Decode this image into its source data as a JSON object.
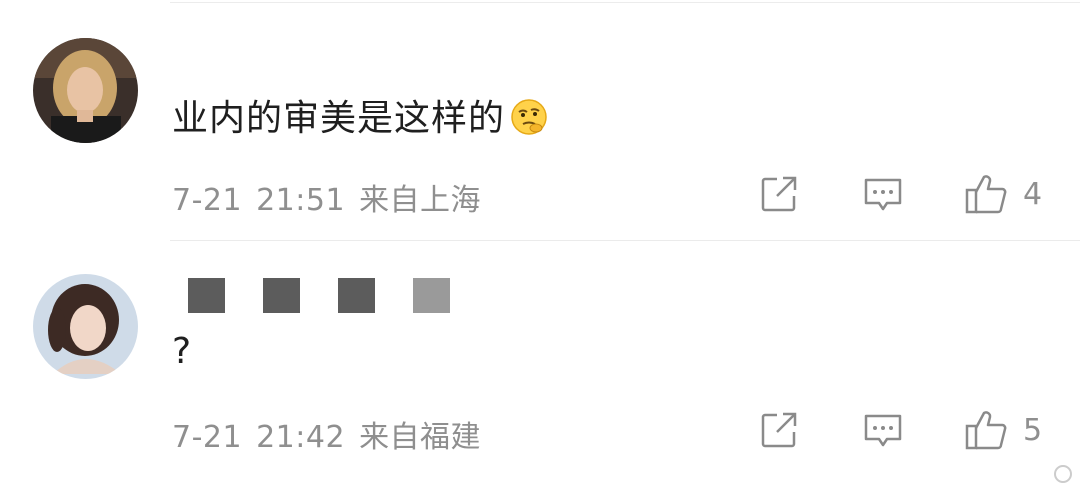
{
  "comments": [
    {
      "username": "",
      "text": "业内的审美是这样的",
      "emoji": "thinking-face-emoji",
      "date": "7-21",
      "time": "21:51",
      "location": "来自上海",
      "likes": "4"
    },
    {
      "username": "",
      "censor_colors": [
        "#5c5c5c",
        "#5c5c5c",
        "#5c5c5c",
        "#9a9a9a"
      ],
      "text": "?",
      "date": "7-21",
      "time": "21:42",
      "location": "来自福建",
      "likes": "5"
    }
  ],
  "colors": {
    "text": "#1f1f1f",
    "meta": "#8f8f8f",
    "divider": "#ebebeb"
  }
}
